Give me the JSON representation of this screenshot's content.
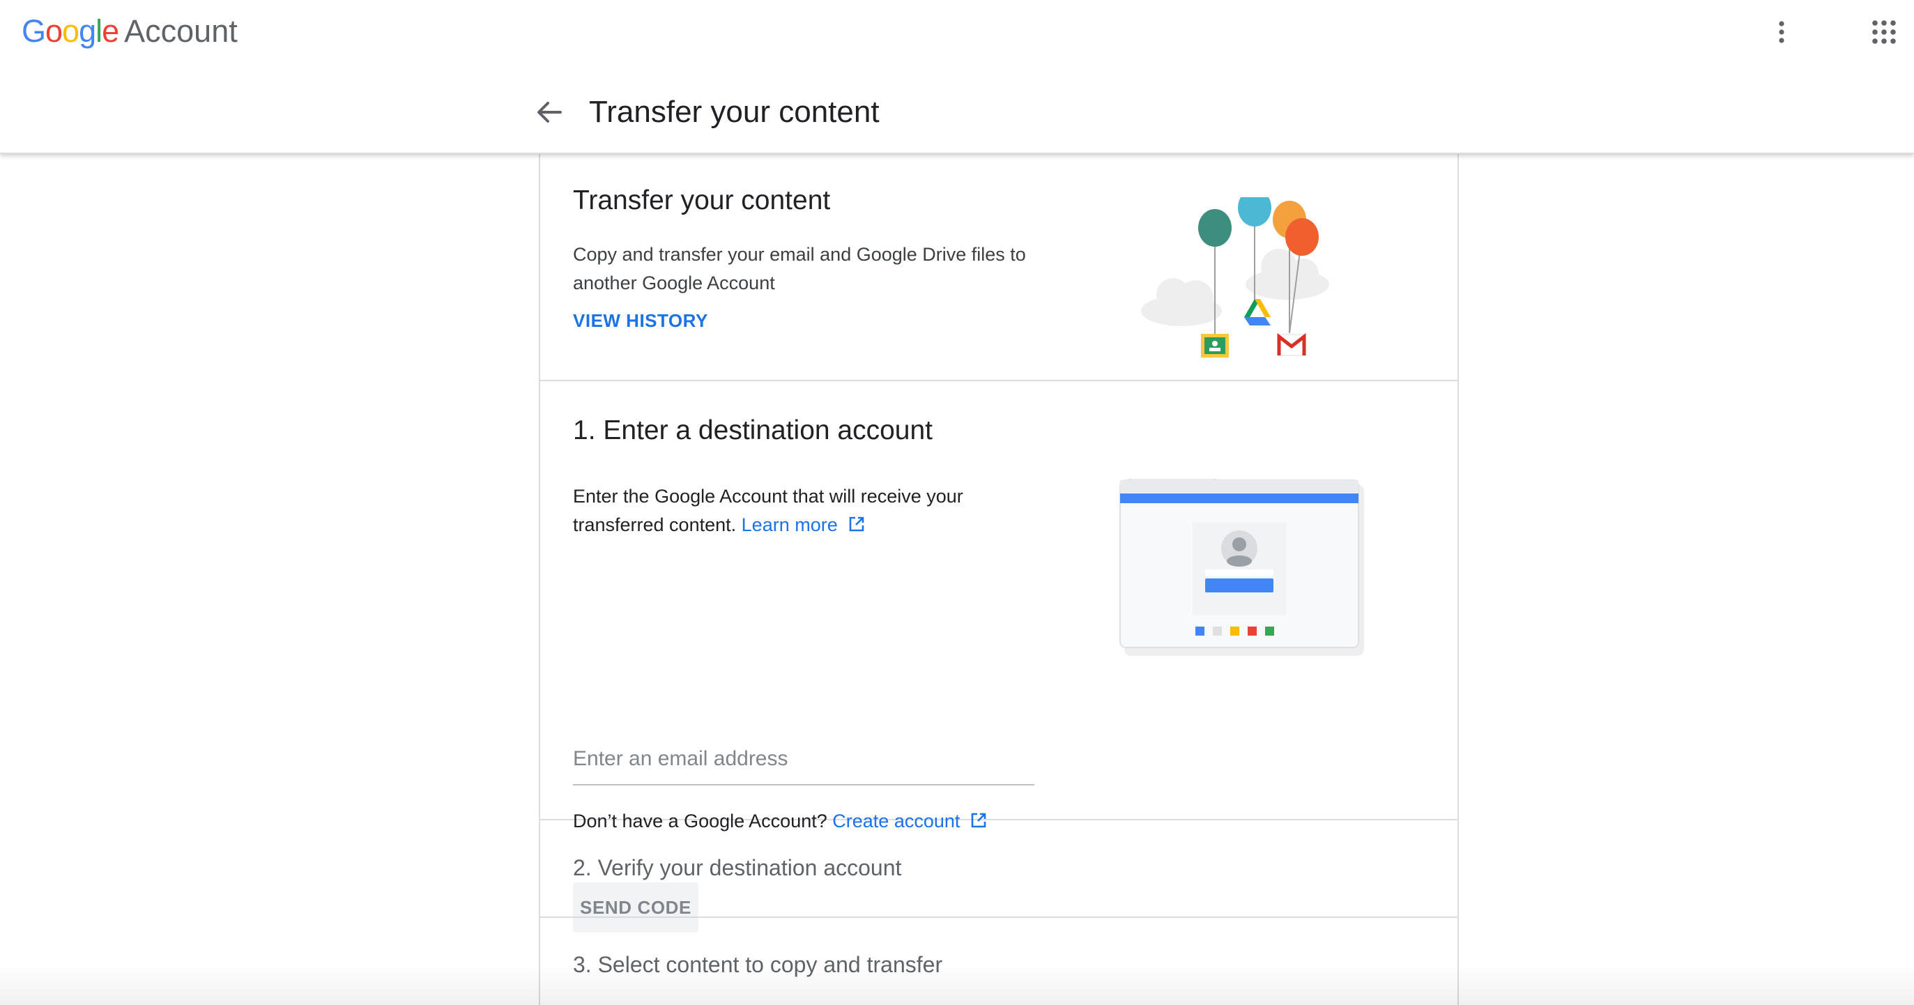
{
  "header": {
    "logo_google": "Google",
    "logo_account": "Account",
    "page_title": "Transfer your content"
  },
  "intro": {
    "title": "Transfer your content",
    "description": "Copy and transfer your email and Google Drive files to another Google Account",
    "view_history": "VIEW HISTORY"
  },
  "step1": {
    "title": "1. Enter a destination account",
    "description": "Enter the Google Account that will receive your transferred content.",
    "learn_more": "Learn more",
    "email_placeholder": "Enter an email address",
    "no_account_text": "Don’t have a Google Account?",
    "create_account": "Create account",
    "send_code": "SEND CODE"
  },
  "step2": {
    "title": "2. Verify your destination account"
  },
  "step3": {
    "title": "3. Select content to copy and transfer"
  },
  "colors": {
    "blue": "#4285F4",
    "red": "#EA4335",
    "yellow": "#FBBC05",
    "green": "#34A853",
    "link": "#1a73e8"
  },
  "icons": [
    "back-arrow-icon",
    "more-vert-icon",
    "apps-grid-icon",
    "external-link-icon"
  ]
}
